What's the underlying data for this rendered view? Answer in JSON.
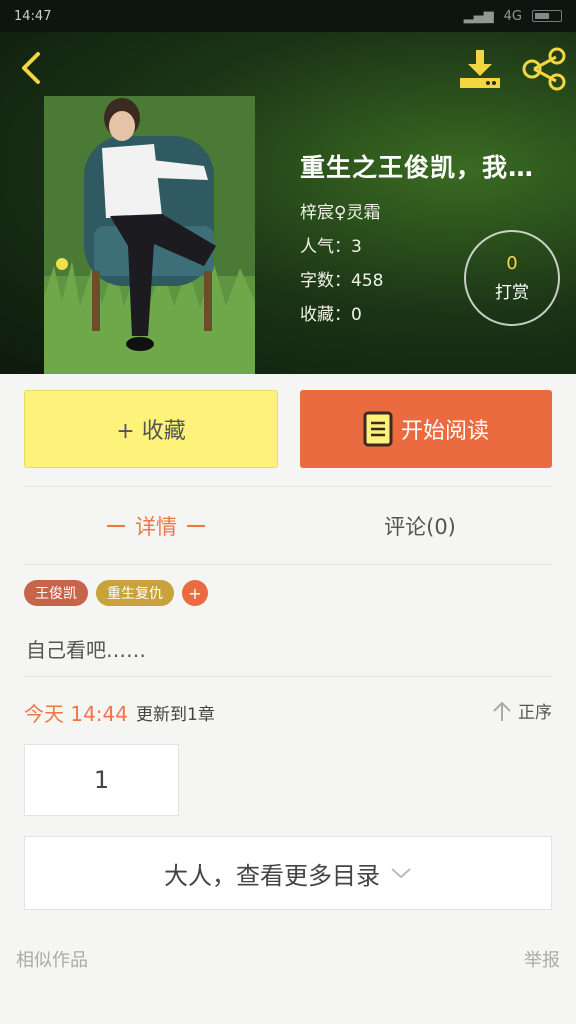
{
  "status_bar": {
    "time": "14:47",
    "network": "4G"
  },
  "header": {
    "back_icon": "chevron-left-icon",
    "download_icon": "download-icon",
    "share_icon": "share-icon"
  },
  "book": {
    "title": "重生之王俊凯，我…",
    "author": "梓宸♀灵霜",
    "popularity": "人气：3",
    "word_count": "字数：458",
    "favorites": "收藏：0"
  },
  "reward": {
    "count": "0",
    "label": "打赏"
  },
  "actions": {
    "favorite_label": "+ 收藏",
    "read_label": "开始阅读"
  },
  "tabs": {
    "detail": "详情",
    "comments": "评论(0)"
  },
  "tags": [
    "王俊凯",
    "重生复仇",
    "+"
  ],
  "description": "自己看吧……",
  "update": {
    "time": "今天 14:44",
    "text": "更新到1章",
    "sort_label": "正序"
  },
  "chapters": [
    "1"
  ],
  "more_catalog": "大人，查看更多目录",
  "footer": {
    "similar": "相似作品",
    "report": "举报"
  },
  "colors": {
    "accent_orange": "#ea6b3f",
    "favorite_yellow": "#fdf27a",
    "reward_gold": "#ffd24a"
  }
}
